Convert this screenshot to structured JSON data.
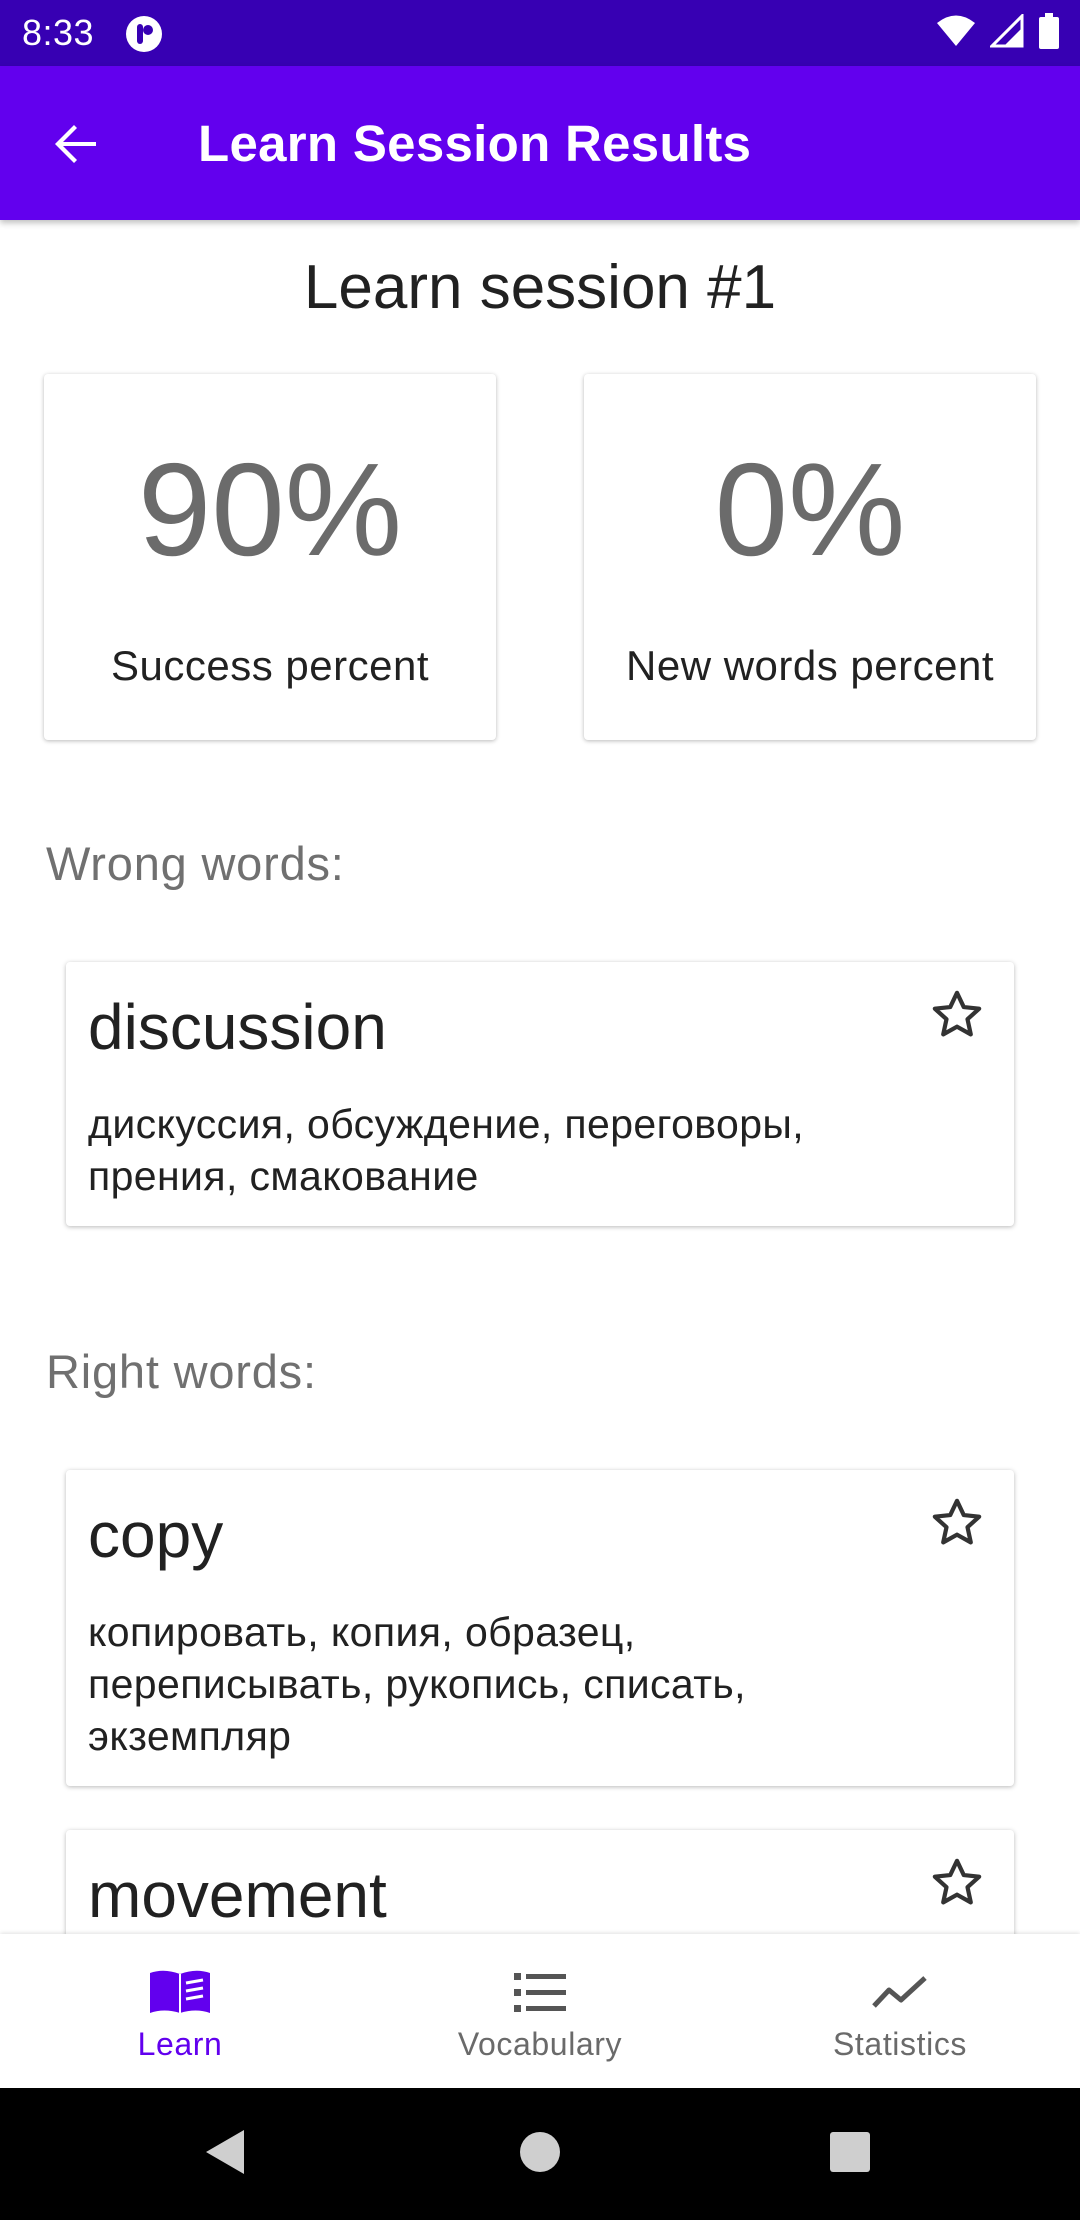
{
  "status_bar": {
    "time": "8:33",
    "icons": [
      "app-notification-icon",
      "wifi-icon",
      "signal-icon",
      "battery-icon"
    ]
  },
  "app_bar": {
    "title": "Learn Session Results",
    "back_icon": "arrow-back-icon",
    "color": "#6200ee",
    "status_color": "#3700b3"
  },
  "session": {
    "title": "Learn session #1"
  },
  "stats": {
    "success_value": "90%",
    "success_label": "Success percent",
    "new_words_value": "0%",
    "new_words_label": "New words percent"
  },
  "wrong_section": {
    "header": "Wrong words:",
    "words": [
      {
        "word": "discussion",
        "translation": "дискуссия, обсуждение, переговоры, прения, смакование",
        "starred": false
      }
    ]
  },
  "right_section": {
    "header": "Right words:",
    "words": [
      {
        "word": "copy",
        "translation": "копировать, копия, образец, переписывать, рукопись, списать, экземпляр",
        "starred": false
      },
      {
        "word": "movement",
        "translation": "",
        "starred": false
      }
    ]
  },
  "bottom_nav": {
    "items": [
      {
        "label": "Learn",
        "icon": "book-icon",
        "active": true
      },
      {
        "label": "Vocabulary",
        "icon": "list-icon",
        "active": false
      },
      {
        "label": "Statistics",
        "icon": "trending-icon",
        "active": false
      }
    ],
    "active_color": "#6200ee"
  },
  "system_nav": {
    "icons": [
      "back-triangle-icon",
      "home-circle-icon",
      "recents-square-icon"
    ]
  }
}
